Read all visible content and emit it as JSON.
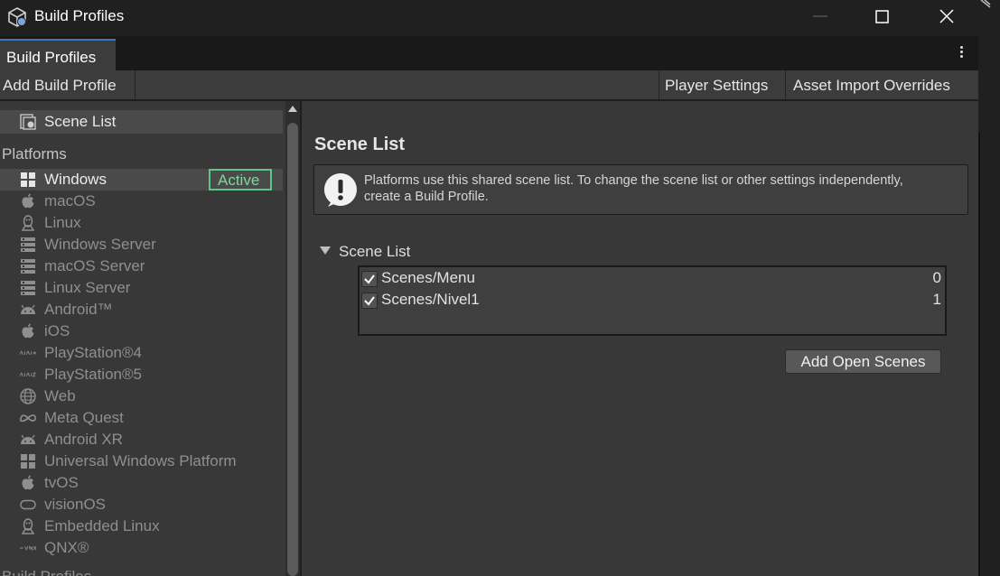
{
  "window": {
    "title": "Build Profiles",
    "icon": "unity-cube-icon"
  },
  "tabs": [
    {
      "label": "Build Profiles",
      "active": true
    }
  ],
  "toolbar": {
    "add_build_profile": "Add Build Profile",
    "player_settings": "Player Settings",
    "asset_import_overrides": "Asset Import Overrides"
  },
  "sidebar": {
    "scene_list_label": "Scene List",
    "platforms_header": "Platforms",
    "active_badge": "Active",
    "platforms": [
      {
        "label": "Windows",
        "icon": "windows-icon",
        "selected": true
      },
      {
        "label": "macOS",
        "icon": "apple-icon"
      },
      {
        "label": "Linux",
        "icon": "linux-icon"
      },
      {
        "label": "Windows Server",
        "icon": "server-icon"
      },
      {
        "label": "macOS Server",
        "icon": "server-icon"
      },
      {
        "label": "Linux Server",
        "icon": "server-icon"
      },
      {
        "label": "Android™",
        "icon": "android-icon"
      },
      {
        "label": "iOS",
        "icon": "apple-icon"
      },
      {
        "label": "PlayStation®4",
        "icon": "ps4-icon"
      },
      {
        "label": "PlayStation®5",
        "icon": "ps5-icon"
      },
      {
        "label": "Web",
        "icon": "web-icon"
      },
      {
        "label": "Meta Quest",
        "icon": "meta-icon"
      },
      {
        "label": "Android XR",
        "icon": "android-icon"
      },
      {
        "label": "Universal Windows Platform",
        "icon": "windows-icon"
      },
      {
        "label": "tvOS",
        "icon": "apple-icon"
      },
      {
        "label": "visionOS",
        "icon": "vision-icon"
      },
      {
        "label": "Embedded Linux",
        "icon": "linux-icon"
      },
      {
        "label": "QNX®",
        "icon": "qnx-icon"
      }
    ],
    "footer_partial": "Build Profiles"
  },
  "main": {
    "title": "Scene List",
    "help_text_line1": "Platforms use this shared scene list. To change the scene list or other settings independently,",
    "help_text_line2": "create a Build Profile.",
    "foldout_label": "Scene List",
    "scenes": [
      {
        "name": "Scenes/Menu",
        "index": "0",
        "checked": true
      },
      {
        "name": "Scenes/Nivel1",
        "index": "1",
        "checked": true
      }
    ],
    "add_open_scenes": "Add Open Scenes"
  },
  "colors": {
    "active_green": "#5cc887",
    "tab_accent": "#3a79bb",
    "panel_bg": "#383838"
  }
}
